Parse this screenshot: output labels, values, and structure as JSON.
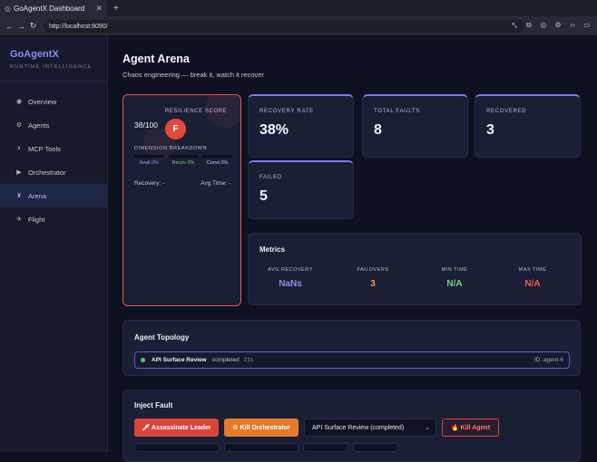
{
  "browser": {
    "tab_title": "GoAgentX Dashboard",
    "url": "http://localhost:8090/"
  },
  "sidebar": {
    "brand": "GoAgentX",
    "brand_sub": "RUNTIME INTELLIGENCE",
    "items": [
      {
        "label": "Overview",
        "icon": "overview-icon"
      },
      {
        "label": "Agents",
        "icon": "agents-icon"
      },
      {
        "label": "MCP Tools",
        "icon": "lightning-icon"
      },
      {
        "label": "Orchestrator",
        "icon": "play-icon"
      },
      {
        "label": "Arena",
        "icon": "arena-icon"
      },
      {
        "label": "Flight",
        "icon": "plane-icon"
      }
    ],
    "active": "Arena"
  },
  "page": {
    "title": "Agent Arena",
    "subtitle": "Chaos engineering — break it, watch it recover"
  },
  "resilience": {
    "score": "38/100",
    "label": "RESILIENCE SCORE",
    "grade": "F",
    "breakdown_label": "DIMENSION BREAKDOWN",
    "avail": "Avail 0%",
    "recov": "Recov 0%",
    "consi": "Consi 0%",
    "recovery": "Recovery: -",
    "avg_time": "Avg Time: -"
  },
  "stats": {
    "recovery_rate": {
      "label": "RECOVERY RATE",
      "value": "38%"
    },
    "total_faults": {
      "label": "TOTAL FAULTS",
      "value": "8"
    },
    "recovered": {
      "label": "RECOVERED",
      "value": "3"
    },
    "failed": {
      "label": "FAILED",
      "value": "5"
    }
  },
  "metrics": {
    "title": "Metrics",
    "avg_recovery": {
      "label": "AVG RECOVERY",
      "value": "NaNs"
    },
    "failovers": {
      "label": "FAILOVERS",
      "value": "3"
    },
    "min_time": {
      "label": "MIN TIME",
      "value": "N/A"
    },
    "max_time": {
      "label": "MAX TIME",
      "value": "N/A"
    }
  },
  "topology": {
    "title": "Agent Topology",
    "agent": {
      "name": "API Surface Review",
      "status": "completed",
      "time": "21s",
      "id": "ID: agent-6"
    }
  },
  "inject": {
    "title": "Inject Fault",
    "assassinate": "🗡 Assassinate Leader",
    "kill_orchestrator": "⚙ Kill Orchestrator",
    "select_value": "API Surface Review (completed)",
    "kill_agent": "🔥 Kill Agent"
  },
  "colors": {
    "accent": "#8b8cf5",
    "danger": "#e2493c",
    "orange": "#e57a2b",
    "green": "#4fcf75",
    "nan_purple": "#8f8cf5",
    "failover_orange": "#f0a23a",
    "min_green": "#6fcf8a",
    "max_red": "#ef5a4e"
  }
}
